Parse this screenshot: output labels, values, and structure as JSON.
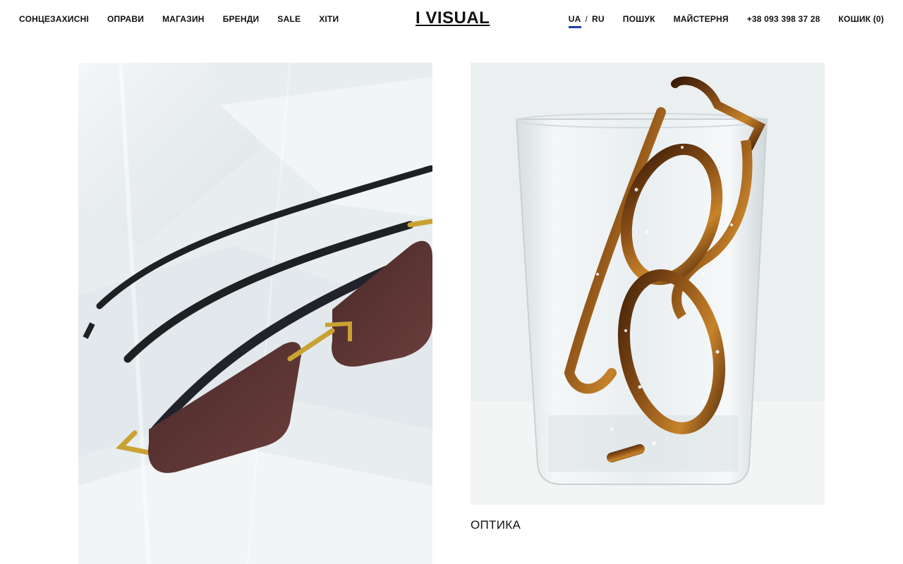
{
  "brand": {
    "logo": "I VISUAL"
  },
  "nav_left": [
    {
      "label": "СОНЦЕЗАХИСНІ"
    },
    {
      "label": "ОПРАВИ"
    },
    {
      "label": "МАГАЗИН"
    },
    {
      "label": "БРЕНДИ"
    },
    {
      "label": "SALE"
    },
    {
      "label": "ХІТИ"
    }
  ],
  "nav_right": {
    "lang_active": "UA",
    "lang_sep": "/",
    "lang_other": "RU",
    "search": "ПОШУК",
    "workshop": "МАЙСТЕРНЯ",
    "phone": "+38 093 398 37 28",
    "cart": "КОШИК (0)"
  },
  "cards": [
    {
      "title": "",
      "image": "rimless-sunglasses-in-plastic-bag-photo"
    },
    {
      "title": "ОПТИКА",
      "image": "tortoiseshell-glasses-in-water-glass-photo"
    }
  ],
  "colors": {
    "accent_underline": "#1e3fae",
    "text": "#111111",
    "background": "#ffffff"
  }
}
